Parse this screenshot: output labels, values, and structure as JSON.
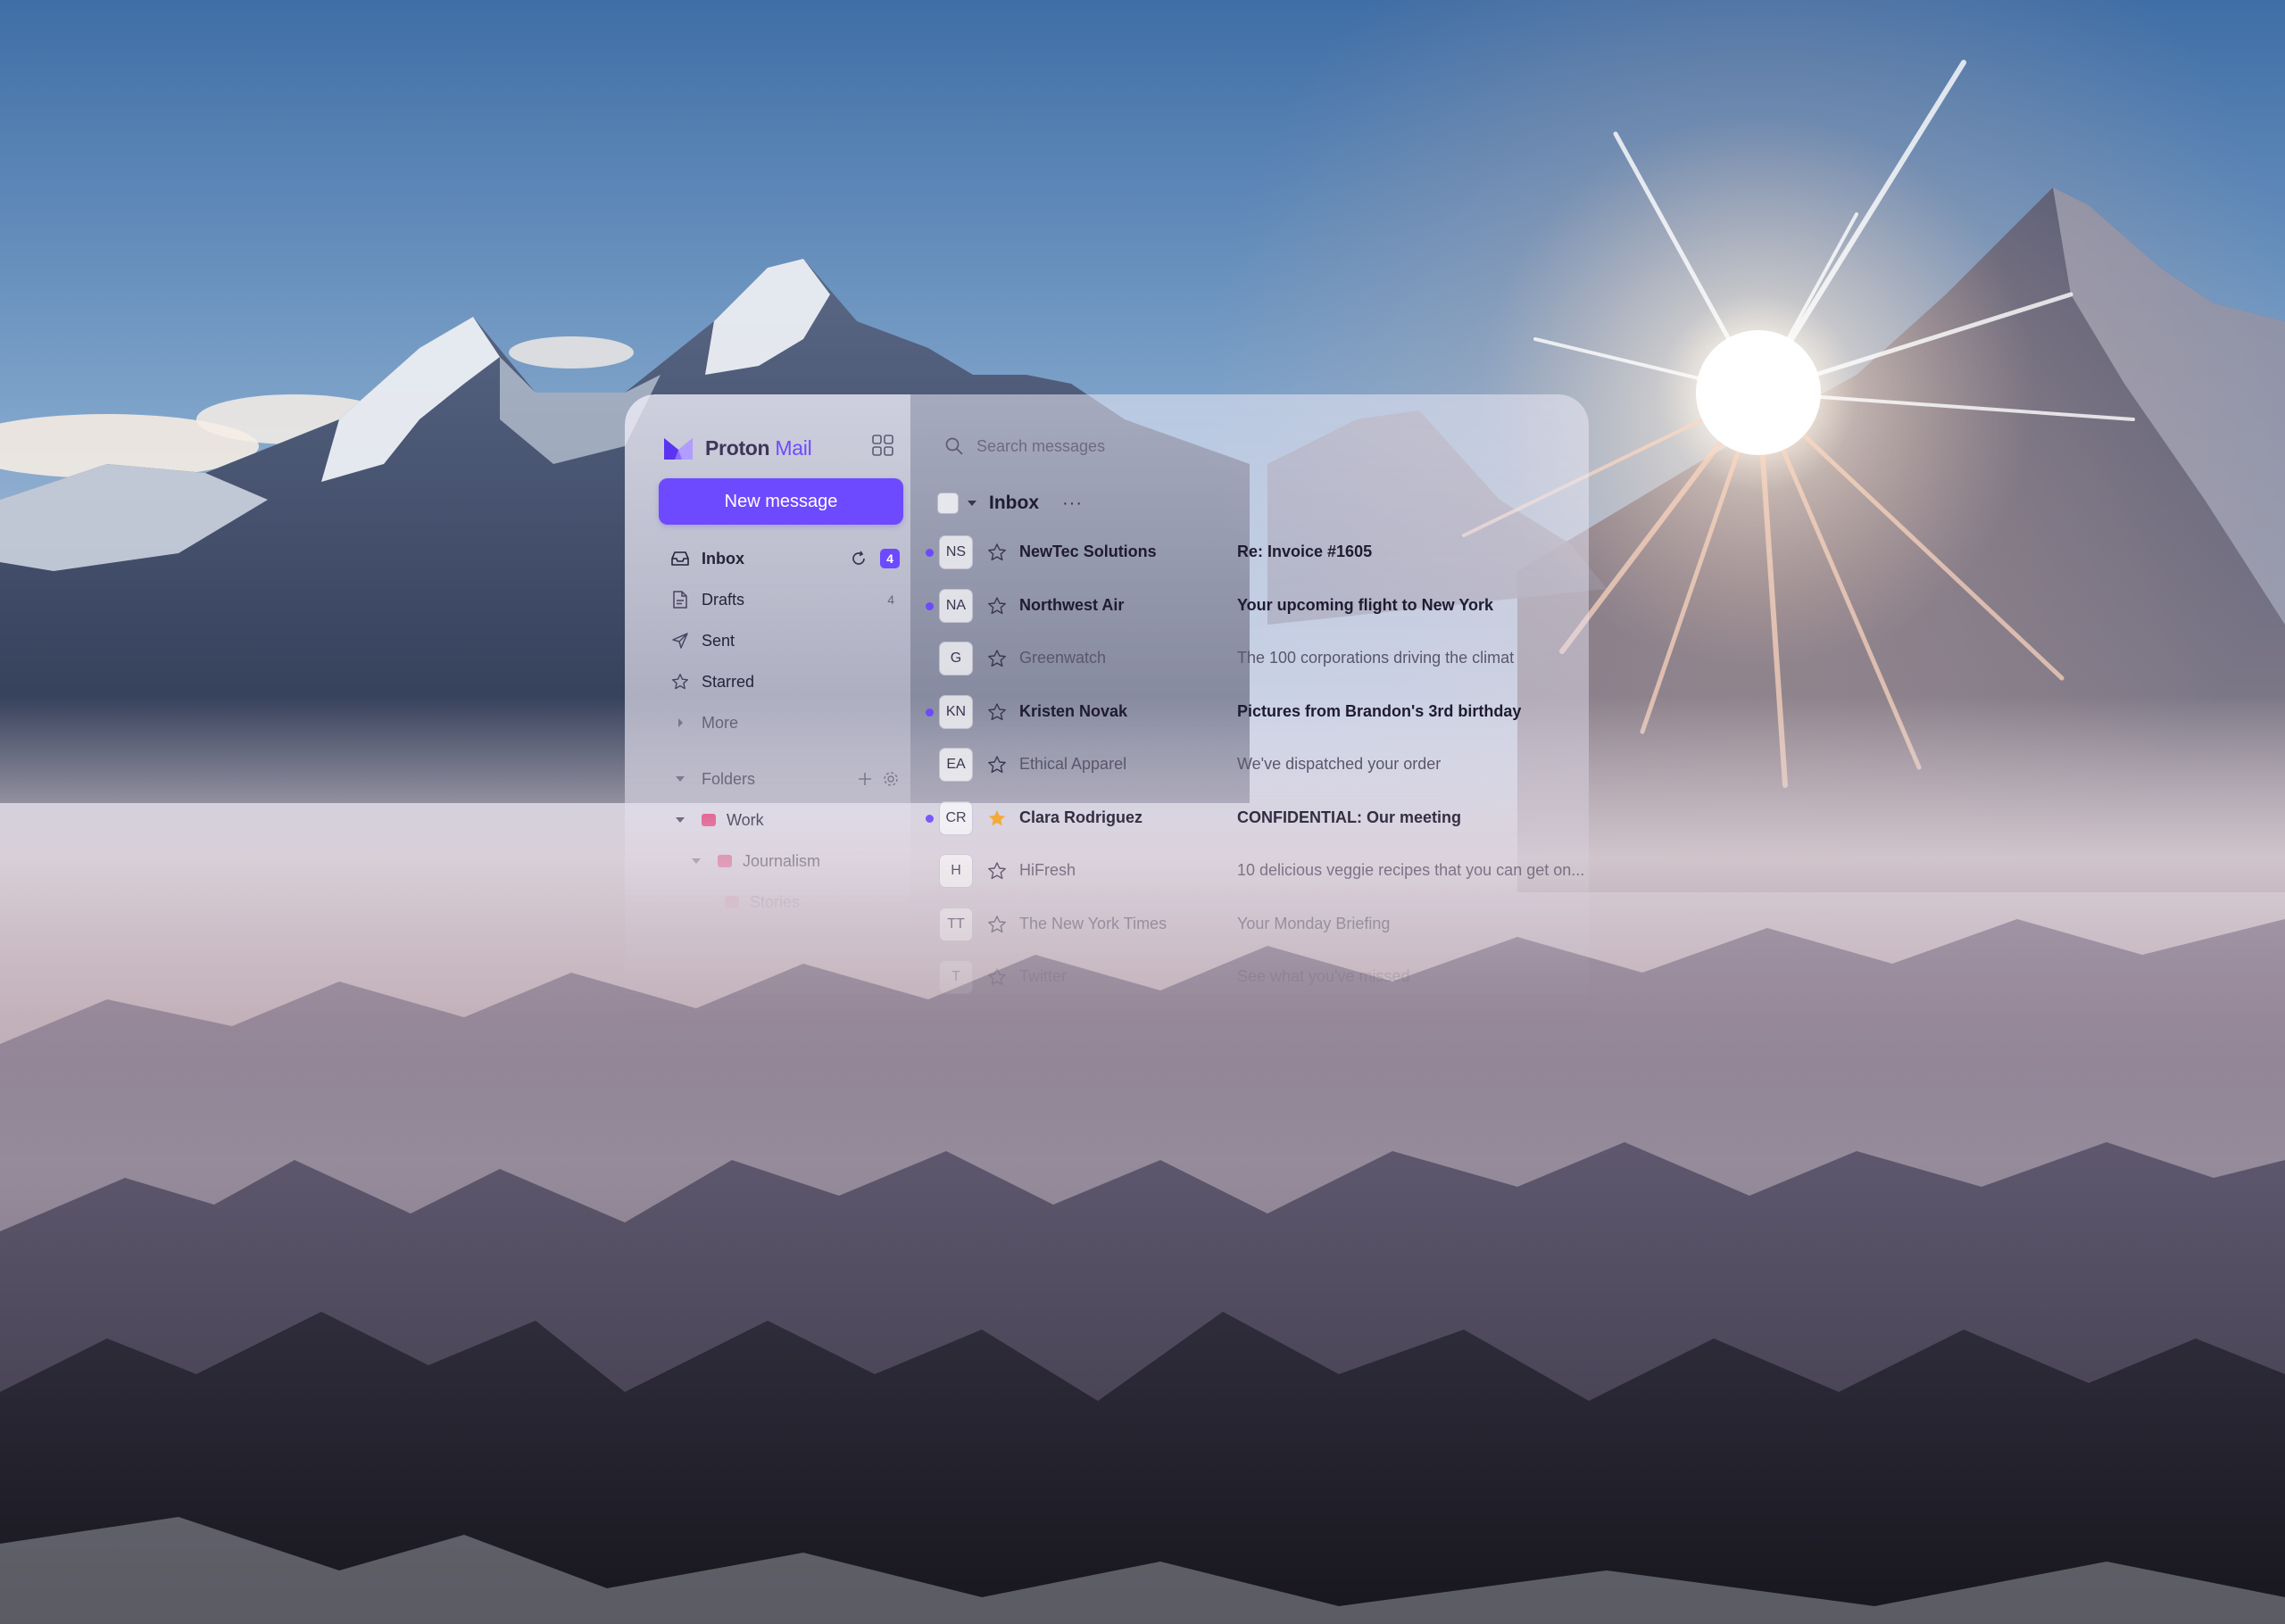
{
  "app": {
    "brand_primary": "Proton",
    "brand_secondary": "Mail",
    "accent_color": "#6d4aff",
    "new_message_label": "New message"
  },
  "sidebar": {
    "items": [
      {
        "label": "Inbox",
        "icon": "inbox-icon",
        "badge": "4",
        "active": true
      },
      {
        "label": "Drafts",
        "icon": "draft-icon",
        "count": "4"
      },
      {
        "label": "Sent",
        "icon": "send-icon"
      },
      {
        "label": "Starred",
        "icon": "star-icon"
      },
      {
        "label": "More",
        "icon": "chevron-right-icon"
      }
    ],
    "folders_label": "Folders",
    "folders": [
      {
        "label": "Work",
        "color": "#e64a7f"
      },
      {
        "label": "Journalism",
        "color": "#e64a7f"
      },
      {
        "label": "Stories",
        "color": "#e64a7f"
      }
    ]
  },
  "search": {
    "placeholder": "Search messages"
  },
  "list": {
    "title": "Inbox",
    "more": "···",
    "messages": [
      {
        "initials": "NS",
        "sender": "NewTec Solutions",
        "subject": "Re: Invoice #1605",
        "unread": true,
        "starred": false
      },
      {
        "initials": "NA",
        "sender": "Northwest Air",
        "subject": "Your upcoming flight to New York",
        "unread": true,
        "starred": false
      },
      {
        "initials": "G",
        "sender": "Greenwatch",
        "subject": "The 100 corporations driving the climat",
        "unread": false,
        "starred": false
      },
      {
        "initials": "KN",
        "sender": "Kristen Novak",
        "subject": "Pictures from Brandon's 3rd birthday",
        "unread": true,
        "starred": false
      },
      {
        "initials": "EA",
        "sender": "Ethical Apparel",
        "subject": "We've dispatched your order",
        "unread": false,
        "starred": false
      },
      {
        "initials": "CR",
        "sender": "Clara Rodriguez",
        "subject": "CONFIDENTIAL: Our meeting",
        "unread": true,
        "starred": true
      },
      {
        "initials": "H",
        "sender": "HiFresh",
        "subject": "10 delicious veggie recipes that you can get on...",
        "unread": false,
        "starred": false
      },
      {
        "initials": "TT",
        "sender": "The New York Times",
        "subject": "Your Monday Briefing",
        "unread": false,
        "starred": false
      },
      {
        "initials": "T",
        "sender": "Twitter",
        "subject": "See what you've missed",
        "unread": false,
        "starred": false
      }
    ]
  }
}
